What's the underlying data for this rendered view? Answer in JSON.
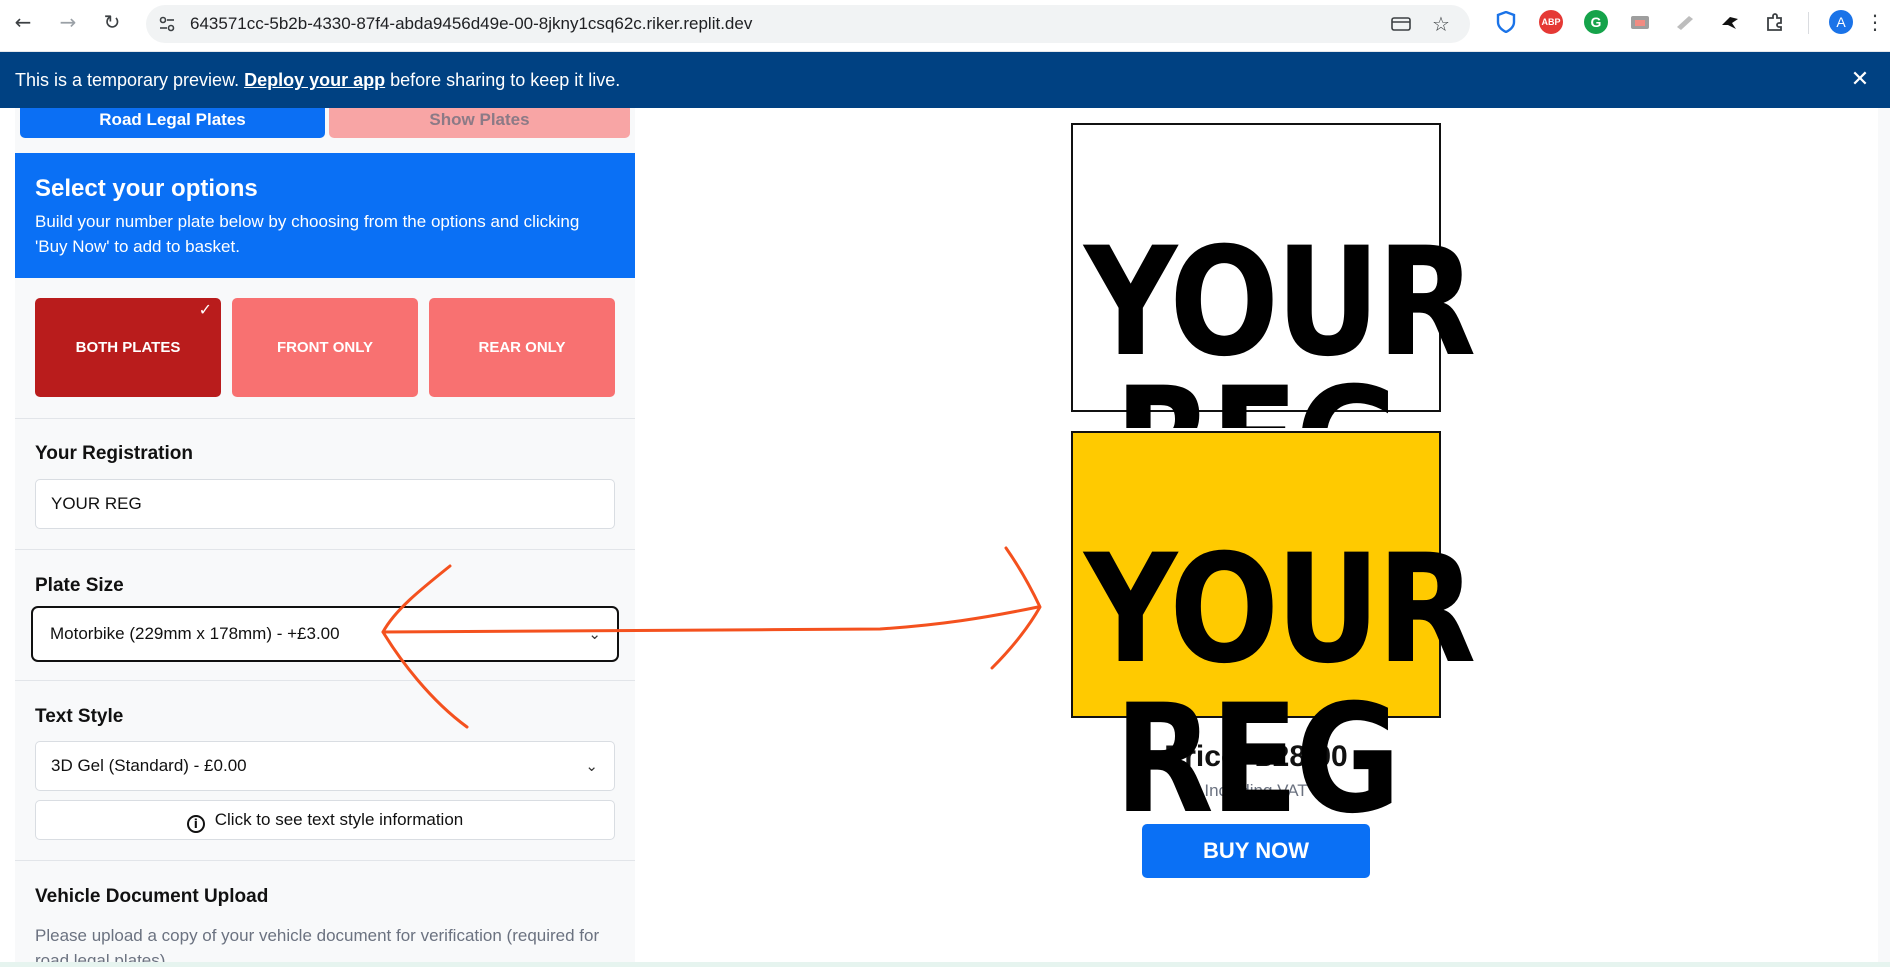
{
  "browser": {
    "url": "643571cc-5b2b-4330-87f4-abda9456d49e-00-8jkny1csq62c.riker.replit.dev",
    "profile_initial": "A",
    "extensions": [
      "shield-icon",
      "abp-icon",
      "grammarly-icon",
      "screen-icon",
      "pen-icon",
      "bird-icon",
      "puzzle-icon"
    ]
  },
  "banner": {
    "prefix": "This is a temporary preview.",
    "link": "Deploy your app",
    "suffix": "before sharing to keep it live."
  },
  "tabs": {
    "active": "Road Legal Plates",
    "inactive": "Show Plates"
  },
  "hero": {
    "title": "Select your options",
    "text": "Build your number plate below by choosing from the options and clicking 'Buy Now' to add to basket."
  },
  "plate_options": [
    {
      "label": "BOTH PLATES",
      "selected": true
    },
    {
      "label": "FRONT ONLY",
      "selected": false
    },
    {
      "label": "REAR ONLY",
      "selected": false
    }
  ],
  "registration": {
    "label": "Your Registration",
    "value": "YOUR REG"
  },
  "plate_size": {
    "label": "Plate Size",
    "value": "Motorbike (229mm x 178mm) - +£3.00"
  },
  "text_style": {
    "label": "Text Style",
    "value": "3D Gel (Standard) - £0.00",
    "info_button": "Click to see text style information"
  },
  "upload": {
    "label": "Vehicle Document Upload",
    "description": "Please upload a copy of your vehicle document for verification (required for road legal plates)"
  },
  "preview": {
    "reg_line1": "YOUR",
    "reg_line2": "REG",
    "price": "Price: £28.00",
    "vat": "Including VAT",
    "buy_label": "BUY NOW"
  },
  "colors": {
    "primary_blue": "#0a70f5",
    "banner_blue": "#004182",
    "selected_red": "#b91c1c",
    "unselected_red": "#f87171",
    "rear_plate_yellow": "#ffca00",
    "annotation_orange": "#f4511e"
  }
}
